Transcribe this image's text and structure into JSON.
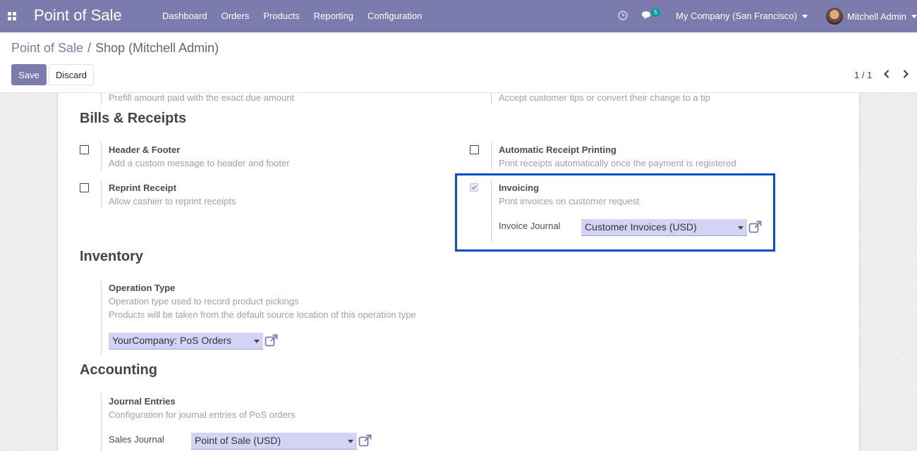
{
  "navbar": {
    "app_title": "Point of Sale",
    "menu": [
      "Dashboard",
      "Orders",
      "Products",
      "Reporting",
      "Configuration"
    ],
    "chat_count": "5",
    "company": "My Company (San Francisco)",
    "user": "Mitchell Admin",
    "color": "#7c7bad"
  },
  "breadcrumb": {
    "parent": "Point of Sale",
    "separator": "/",
    "current": "Shop (Mitchell Admin)"
  },
  "buttons": {
    "save": "Save",
    "discard": "Discard"
  },
  "pager": {
    "value": "1 / 1"
  },
  "form": {
    "top_left_desc": "Prefill amount paid with the exact due amount",
    "top_right_desc": "Accept customer tips or convert their change to a tip",
    "bills": {
      "title": "Bills & Receipts",
      "header_footer": {
        "label": "Header & Footer",
        "desc": "Add a custom message to header and footer",
        "checked": false
      },
      "auto_print": {
        "label": "Automatic Receipt Printing",
        "desc": "Print receipts automatically once the payment is registered",
        "checked": false
      },
      "reprint": {
        "label": "Reprint Receipt",
        "desc": "Allow cashier to reprint receipts",
        "checked": false
      },
      "invoicing": {
        "label": "Invoicing",
        "desc": "Print invoices on customer request",
        "checked": true,
        "journal_label": "Invoice Journal",
        "journal_value": "Customer Invoices (USD)"
      }
    },
    "inventory": {
      "title": "Inventory",
      "operation_type": {
        "label": "Operation Type",
        "desc1": "Operation type used to record product pickings",
        "desc2": "Products will be taken from the default source location of this operation type",
        "value": "YourCompany: PoS Orders"
      }
    },
    "accounting": {
      "title": "Accounting",
      "journal_entries": {
        "label": "Journal Entries",
        "desc": "Configuration for journal entries of PoS orders",
        "sales_journal_label": "Sales Journal",
        "sales_journal_value": "Point of Sale (USD)"
      }
    }
  },
  "colors": {
    "highlight": "#0d4fc2",
    "select_bg": "#d3d3f5",
    "accent": "#7c7bad"
  }
}
